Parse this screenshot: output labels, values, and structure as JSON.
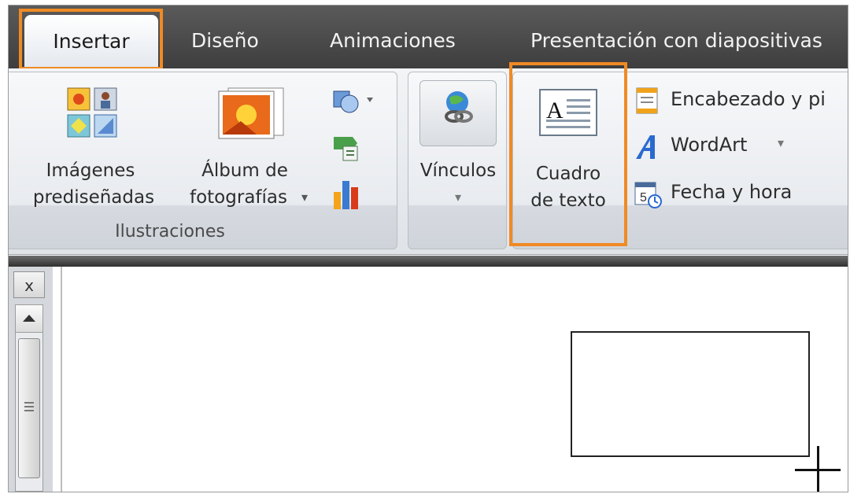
{
  "tabs": [
    {
      "label": "Insertar",
      "active": true
    },
    {
      "label": "Diseño"
    },
    {
      "label": "Animaciones"
    },
    {
      "label": "Presentación con diapositivas"
    }
  ],
  "ribbon": {
    "ilustraciones": {
      "group_label": "Ilustraciones",
      "clipart_label": "Imágenes prediseñadas",
      "clipart_line1": "Imágenes",
      "clipart_line2": "prediseñadas",
      "album_line1": "Álbum de",
      "album_line2": "fotografías",
      "album_dropdown": "▾"
    },
    "vinculos": {
      "label": "Vínculos",
      "dropdown": "▾"
    },
    "texto": {
      "cuadro_line1": "Cuadro",
      "cuadro_line2": "de texto",
      "encabezado_label": "Encabezado y pi",
      "wordart_label": "WordArt",
      "wordart_dropdown": "▾",
      "fecha_label": "Fecha y hora"
    }
  },
  "left_panel": {
    "close_label": "x"
  },
  "colors": {
    "highlight": "#f08a24",
    "tab_bar": "#4a4a4a"
  }
}
